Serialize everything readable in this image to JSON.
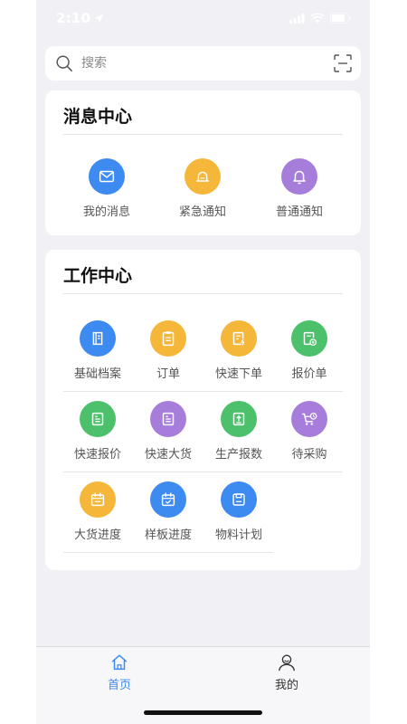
{
  "status_bar": {
    "time": "2:10"
  },
  "search": {
    "placeholder": "搜索"
  },
  "message_center": {
    "title": "消息中心",
    "items": [
      {
        "label": "我的消息",
        "icon": "mail-icon",
        "color": "#3d8af0"
      },
      {
        "label": "紧急通知",
        "icon": "alarm-icon",
        "color": "#f4b73a"
      },
      {
        "label": "普通通知",
        "icon": "bell-icon",
        "color": "#a77ddb"
      }
    ]
  },
  "work_center": {
    "title": "工作中心",
    "items": [
      {
        "label": "基础档案",
        "icon": "archive-icon",
        "color": "#3d8af0"
      },
      {
        "label": "订单",
        "icon": "order-icon",
        "color": "#f4b73a"
      },
      {
        "label": "快速下单",
        "icon": "quick-order-icon",
        "color": "#f4b73a"
      },
      {
        "label": "报价单",
        "icon": "quote-icon",
        "color": "#4cc06a"
      },
      {
        "label": "快速报价",
        "icon": "quick-quote-icon",
        "color": "#4cc06a"
      },
      {
        "label": "快速大货",
        "icon": "bulk-goods-icon",
        "color": "#a77ddb"
      },
      {
        "label": "生产报数",
        "icon": "production-report-icon",
        "color": "#4cc06a"
      },
      {
        "label": "待采购",
        "icon": "cart-icon",
        "color": "#a77ddb"
      },
      {
        "label": "大货进度",
        "icon": "calendar-icon",
        "color": "#f4b73a"
      },
      {
        "label": "样板进度",
        "icon": "calendar-check-icon",
        "color": "#3d8af0"
      },
      {
        "label": "物料计划",
        "icon": "material-plan-icon",
        "color": "#3d8af0"
      }
    ]
  },
  "tab_bar": {
    "tabs": [
      {
        "label": "首页",
        "icon": "home-icon",
        "active": true
      },
      {
        "label": "我的",
        "icon": "user-icon",
        "active": false
      }
    ],
    "active_color": "#3d8af0",
    "inactive_color": "#333333"
  }
}
